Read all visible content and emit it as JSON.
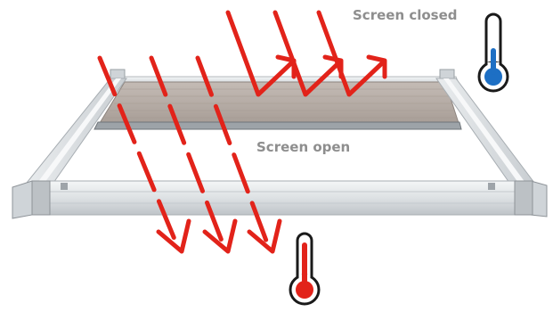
{
  "labels": {
    "screen_closed": "Screen closed",
    "screen_open": "Screen open"
  },
  "icons": {
    "arrow": "sun-ray-arrow-icon",
    "thermometer_cool": "thermometer-cool-icon",
    "thermometer_hot": "thermometer-hot-icon"
  },
  "colors": {
    "ray": "#e2231a",
    "hot": "#e2231a",
    "cool": "#1d6fc4",
    "screen_fabric": "#b7aea7",
    "frame": "#dfe3e6",
    "label_text": "#8e8e8e"
  }
}
